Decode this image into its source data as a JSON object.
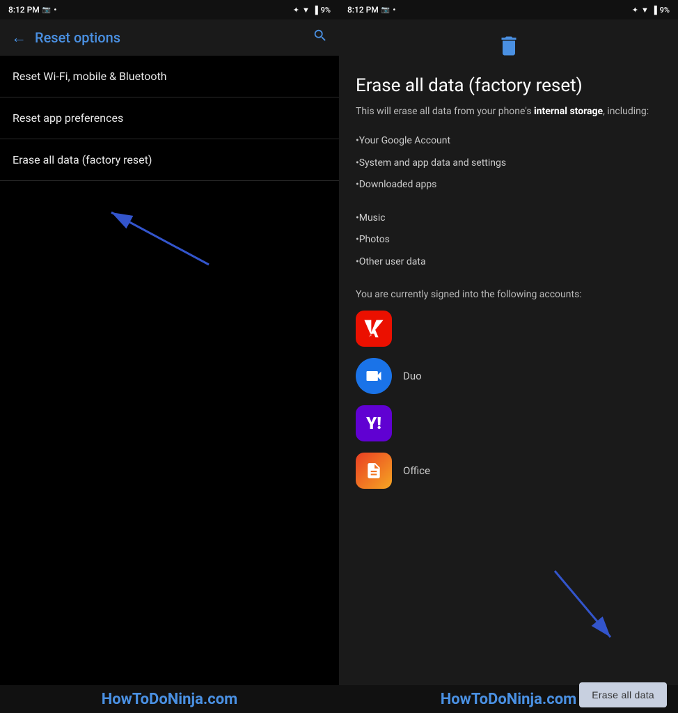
{
  "left": {
    "statusBar": {
      "time": "8:12 PM",
      "battery": "9%"
    },
    "toolbar": {
      "backLabel": "←",
      "title": "Reset options",
      "searchLabel": "🔍"
    },
    "menuItems": [
      {
        "label": "Reset Wi-Fi, mobile & Bluetooth"
      },
      {
        "label": "Reset app preferences"
      },
      {
        "label": "Erase all data (factory reset)"
      }
    ]
  },
  "right": {
    "statusBar": {
      "time": "8:12 PM",
      "battery": "9%"
    },
    "trashIcon": "🗑",
    "title": "Erase all data (factory reset)",
    "introText": "This will erase all data from your phone's ",
    "introTextBold": "internal storage",
    "introTextEnd": ", including:",
    "dataItems": [
      "•Your Google Account",
      "•System and app data and settings",
      "•Downloaded apps",
      "•Music",
      "•Photos",
      "•Other user data"
    ],
    "accountsText": "You are currently signed into the following accounts:",
    "accounts": [
      {
        "name": "Adobe",
        "type": "adobe",
        "label": ""
      },
      {
        "name": "Duo",
        "type": "duo",
        "label": "Duo"
      },
      {
        "name": "Yahoo",
        "type": "yahoo",
        "label": ""
      },
      {
        "name": "Office",
        "type": "office",
        "label": "Office"
      }
    ],
    "eraseButton": "Erase all data"
  },
  "watermark": "HowToDoNinja.com"
}
